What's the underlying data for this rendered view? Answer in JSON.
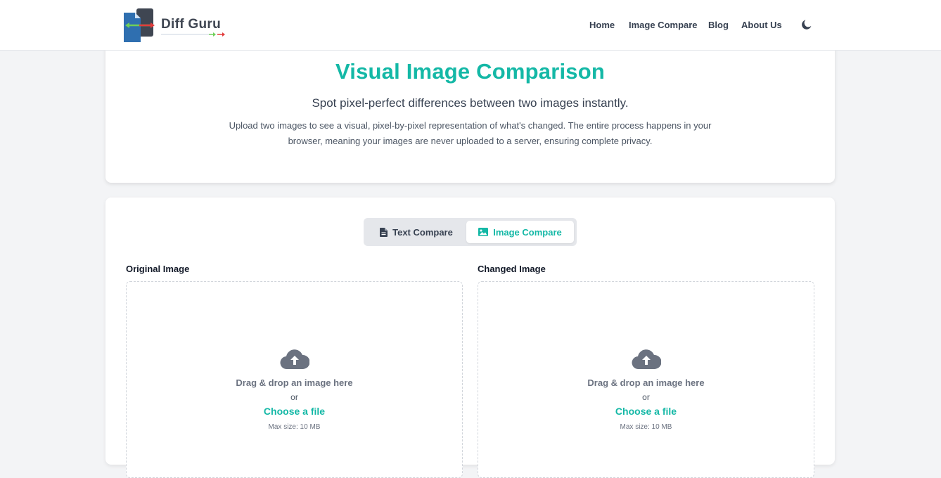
{
  "brand": {
    "name": "Diff Guru"
  },
  "nav": {
    "home": "Home",
    "image_compare": "Image Compare",
    "blog": "Blog",
    "about": "About Us"
  },
  "hero": {
    "title": "Visual Image Comparison",
    "subtitle": "Spot pixel-perfect differences between two images instantly.",
    "description": "Upload two images to see a visual, pixel-by-pixel representation of what's changed. The entire process happens in your browser, meaning your images are never uploaded to a server, ensuring complete privacy."
  },
  "toggle": {
    "text_compare": "Text Compare",
    "image_compare": "Image Compare",
    "active": "image_compare"
  },
  "upload": {
    "original_label": "Original Image",
    "changed_label": "Changed Image",
    "drag_text": "Drag & drop an image here",
    "or_text": "or",
    "choose_text": "Choose a file",
    "max_size": "Max size: 10 MB"
  },
  "colors": {
    "accent": "#14b8a6",
    "text_dark": "#374151",
    "background": "#f3f4f6"
  },
  "icons": {
    "theme_toggle": "moon-icon",
    "text_compare": "file-text-icon",
    "image_compare": "image-icon",
    "upload": "cloud-upload-icon"
  }
}
